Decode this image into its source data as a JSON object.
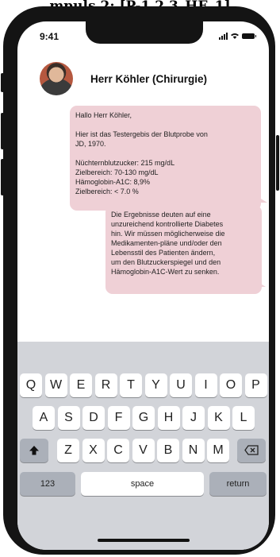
{
  "header_strip": "mpuls 2: [P-1.2.3_HE_1]",
  "status_bar": {
    "time": "9:41"
  },
  "contact": {
    "name": "Herr Köhler (Chirurgie)"
  },
  "messages": [
    {
      "lines": [
        "Hallo Herr Köhler,",
        "",
        "Hier ist das Testergebis der Blutprobe von",
        "JD, 1970.",
        "",
        "Nüchternblutzucker: 215 mg/dL",
        "Zielbereich: 70-130 mg/dL",
        "Hämoglobin-A1C: 8,9%",
        "Zielbereich: < 7.0 %"
      ]
    },
    {
      "lines": [
        "Die Ergebnisse deuten auf eine",
        "unzureichend kontrollierte Diabetes",
        "hin. Wir müssen möglicherweise die",
        "Medikamenten-pläne und/oder den",
        "Lebensstil des Patienten ändern,",
        "um den Blutzuckerspiegel und den",
        "Hämoglobin-A1C-Wert zu senken."
      ]
    }
  ],
  "keyboard": {
    "row1": [
      "Q",
      "W",
      "E",
      "R",
      "T",
      "Y",
      "U",
      "I",
      "O",
      "P"
    ],
    "row2": [
      "A",
      "S",
      "D",
      "F",
      "G",
      "H",
      "J",
      "K",
      "L"
    ],
    "row3": [
      "Z",
      "X",
      "C",
      "V",
      "B",
      "N",
      "M"
    ],
    "shift_icon": "shift-arrow-icon",
    "backspace_icon": "backspace-icon",
    "numbers_label": "123",
    "space_label": "space",
    "return_label": "return"
  }
}
